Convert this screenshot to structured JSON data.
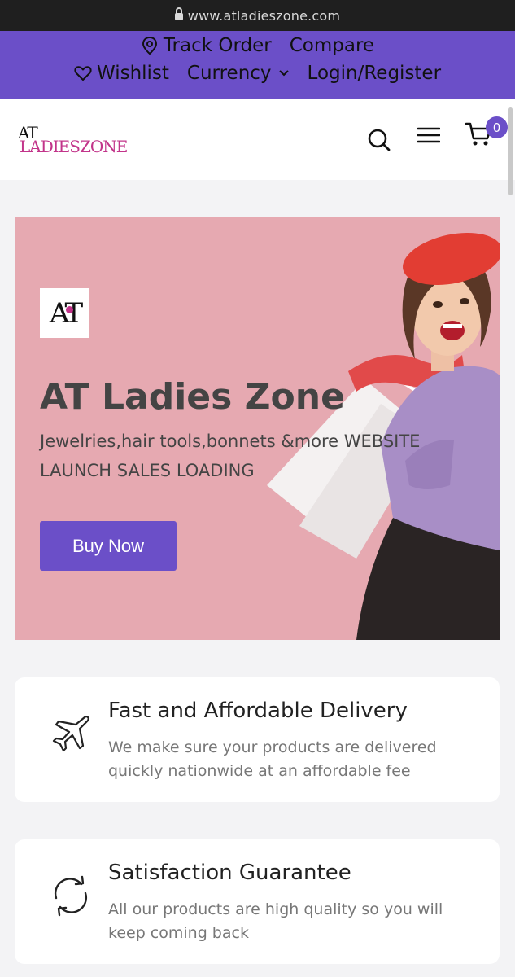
{
  "browser": {
    "url": "www.atladieszone.com"
  },
  "topbar": {
    "track_order": "Track Order",
    "compare": "Compare",
    "wishlist": "Wishlist",
    "currency": "Currency",
    "login_register": "Login/Register"
  },
  "header": {
    "logo_top": "AT",
    "logo_bottom": "LADIESZONE",
    "cart_count": "0",
    "icons": [
      "search-icon",
      "menu-icon",
      "cart-icon"
    ]
  },
  "hero": {
    "logo_text": "AT",
    "title": "AT Ladies Zone",
    "subtitle": "Jewelries,hair tools,bonnets &more WEBSITE LAUNCH SALES LOADING",
    "button": "Buy Now",
    "background_color": "#e6a9b1"
  },
  "features": [
    {
      "icon": "airplane-icon",
      "title": "Fast and Affordable Delivery",
      "description": "We make sure your products are delivered quickly nationwide at an affordable fee"
    },
    {
      "icon": "refresh-icon",
      "title": "Satisfaction Guarantee",
      "description": "All our products are high quality so you will keep coming back"
    }
  ],
  "colors": {
    "accent": "#6b4fc8",
    "brand_pink": "#c2348a",
    "page_background": "#f3f3f5"
  }
}
